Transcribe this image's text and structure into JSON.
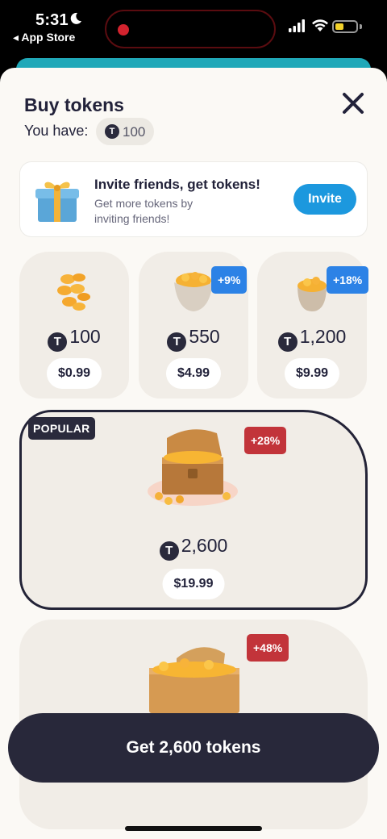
{
  "status_bar": {
    "time": "5:31",
    "back_label": "◂ App Store"
  },
  "header": {
    "title": "Buy tokens",
    "have_label": "You have:",
    "balance": "100",
    "token_symbol": "T"
  },
  "invite": {
    "title": "Invite friends, get tokens!",
    "subtitle": "Get more tokens by inviting friends!",
    "button_label": "Invite"
  },
  "packs": [
    {
      "amount": "100",
      "price": "$0.99",
      "bonus": ""
    },
    {
      "amount": "550",
      "price": "$4.99",
      "bonus": "+9%"
    },
    {
      "amount": "1,200",
      "price": "$9.99",
      "bonus": "+18%"
    }
  ],
  "popular_pack": {
    "tag": "POPULAR",
    "amount": "2,600",
    "price": "$19.99",
    "bonus": "+28%"
  },
  "next_pack": {
    "bonus": "+48%"
  },
  "cta": {
    "label": "Get 2,600 tokens"
  },
  "colors": {
    "accent_blue": "#1c98de",
    "bonus_blue": "#2c82e6",
    "bonus_red": "#c2343a",
    "dark": "#28283a",
    "sheet_bg": "#fbf9f5",
    "card_bg": "#f1ede7"
  },
  "icons": [
    "moon-icon",
    "signal-icon",
    "wifi-icon",
    "battery-icon",
    "close-icon",
    "token-icon",
    "gift-icon",
    "coins-icon",
    "egg-coins-icon",
    "chest-icon"
  ]
}
